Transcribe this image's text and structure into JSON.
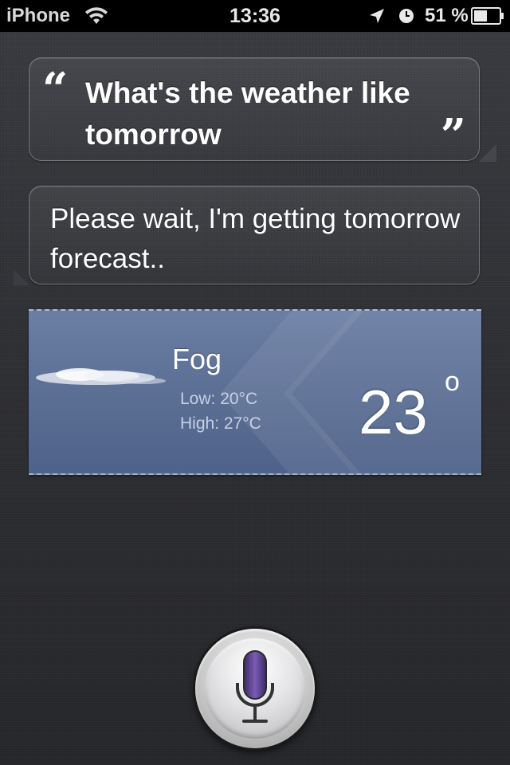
{
  "status_bar": {
    "carrier": "iPhone",
    "time": "13:36",
    "battery_percent": "51 %",
    "icons": [
      "wifi-icon",
      "location-arrow-icon",
      "alarm-clock-icon",
      "battery-icon"
    ]
  },
  "conversation": {
    "user_query": "What's the weather like tomorrow",
    "quote_open": "“",
    "quote_close": "”",
    "siri_response": "Please wait, I'm getting tomorrow forecast.."
  },
  "weather": {
    "condition": "Fog",
    "low": "Low: 20°C",
    "high": "High: 27°C",
    "current_temp": "23",
    "degree_symbol": "o",
    "icon": "fog-cloud-icon",
    "colors": {
      "card": "#5d7196",
      "secondary_text": "#c7d0e2"
    }
  },
  "mic": {
    "icon": "microphone-icon",
    "accent": "#5a3f8c"
  }
}
